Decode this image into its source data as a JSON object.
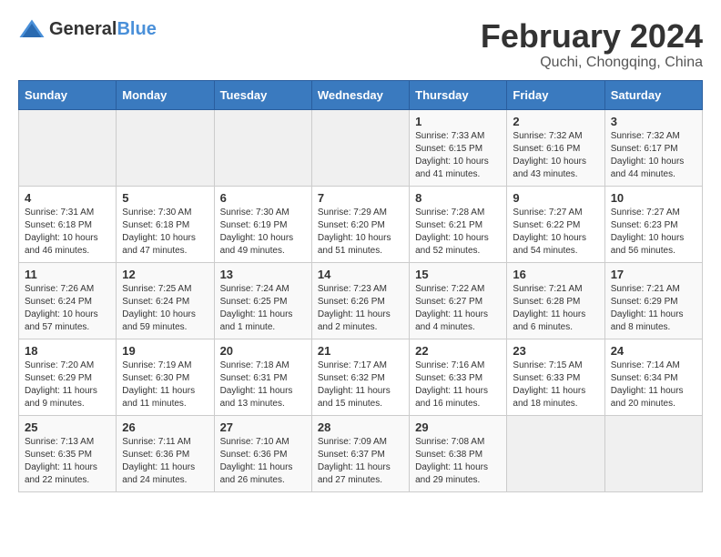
{
  "header": {
    "logo_general": "General",
    "logo_blue": "Blue",
    "month_year": "February 2024",
    "location": "Quchi, Chongqing, China"
  },
  "weekdays": [
    "Sunday",
    "Monday",
    "Tuesday",
    "Wednesday",
    "Thursday",
    "Friday",
    "Saturday"
  ],
  "weeks": [
    [
      {
        "day": "",
        "info": ""
      },
      {
        "day": "",
        "info": ""
      },
      {
        "day": "",
        "info": ""
      },
      {
        "day": "",
        "info": ""
      },
      {
        "day": "1",
        "info": "Sunrise: 7:33 AM\nSunset: 6:15 PM\nDaylight: 10 hours\nand 41 minutes."
      },
      {
        "day": "2",
        "info": "Sunrise: 7:32 AM\nSunset: 6:16 PM\nDaylight: 10 hours\nand 43 minutes."
      },
      {
        "day": "3",
        "info": "Sunrise: 7:32 AM\nSunset: 6:17 PM\nDaylight: 10 hours\nand 44 minutes."
      }
    ],
    [
      {
        "day": "4",
        "info": "Sunrise: 7:31 AM\nSunset: 6:18 PM\nDaylight: 10 hours\nand 46 minutes."
      },
      {
        "day": "5",
        "info": "Sunrise: 7:30 AM\nSunset: 6:18 PM\nDaylight: 10 hours\nand 47 minutes."
      },
      {
        "day": "6",
        "info": "Sunrise: 7:30 AM\nSunset: 6:19 PM\nDaylight: 10 hours\nand 49 minutes."
      },
      {
        "day": "7",
        "info": "Sunrise: 7:29 AM\nSunset: 6:20 PM\nDaylight: 10 hours\nand 51 minutes."
      },
      {
        "day": "8",
        "info": "Sunrise: 7:28 AM\nSunset: 6:21 PM\nDaylight: 10 hours\nand 52 minutes."
      },
      {
        "day": "9",
        "info": "Sunrise: 7:27 AM\nSunset: 6:22 PM\nDaylight: 10 hours\nand 54 minutes."
      },
      {
        "day": "10",
        "info": "Sunrise: 7:27 AM\nSunset: 6:23 PM\nDaylight: 10 hours\nand 56 minutes."
      }
    ],
    [
      {
        "day": "11",
        "info": "Sunrise: 7:26 AM\nSunset: 6:24 PM\nDaylight: 10 hours\nand 57 minutes."
      },
      {
        "day": "12",
        "info": "Sunrise: 7:25 AM\nSunset: 6:24 PM\nDaylight: 10 hours\nand 59 minutes."
      },
      {
        "day": "13",
        "info": "Sunrise: 7:24 AM\nSunset: 6:25 PM\nDaylight: 11 hours\nand 1 minute."
      },
      {
        "day": "14",
        "info": "Sunrise: 7:23 AM\nSunset: 6:26 PM\nDaylight: 11 hours\nand 2 minutes."
      },
      {
        "day": "15",
        "info": "Sunrise: 7:22 AM\nSunset: 6:27 PM\nDaylight: 11 hours\nand 4 minutes."
      },
      {
        "day": "16",
        "info": "Sunrise: 7:21 AM\nSunset: 6:28 PM\nDaylight: 11 hours\nand 6 minutes."
      },
      {
        "day": "17",
        "info": "Sunrise: 7:21 AM\nSunset: 6:29 PM\nDaylight: 11 hours\nand 8 minutes."
      }
    ],
    [
      {
        "day": "18",
        "info": "Sunrise: 7:20 AM\nSunset: 6:29 PM\nDaylight: 11 hours\nand 9 minutes."
      },
      {
        "day": "19",
        "info": "Sunrise: 7:19 AM\nSunset: 6:30 PM\nDaylight: 11 hours\nand 11 minutes."
      },
      {
        "day": "20",
        "info": "Sunrise: 7:18 AM\nSunset: 6:31 PM\nDaylight: 11 hours\nand 13 minutes."
      },
      {
        "day": "21",
        "info": "Sunrise: 7:17 AM\nSunset: 6:32 PM\nDaylight: 11 hours\nand 15 minutes."
      },
      {
        "day": "22",
        "info": "Sunrise: 7:16 AM\nSunset: 6:33 PM\nDaylight: 11 hours\nand 16 minutes."
      },
      {
        "day": "23",
        "info": "Sunrise: 7:15 AM\nSunset: 6:33 PM\nDaylight: 11 hours\nand 18 minutes."
      },
      {
        "day": "24",
        "info": "Sunrise: 7:14 AM\nSunset: 6:34 PM\nDaylight: 11 hours\nand 20 minutes."
      }
    ],
    [
      {
        "day": "25",
        "info": "Sunrise: 7:13 AM\nSunset: 6:35 PM\nDaylight: 11 hours\nand 22 minutes."
      },
      {
        "day": "26",
        "info": "Sunrise: 7:11 AM\nSunset: 6:36 PM\nDaylight: 11 hours\nand 24 minutes."
      },
      {
        "day": "27",
        "info": "Sunrise: 7:10 AM\nSunset: 6:36 PM\nDaylight: 11 hours\nand 26 minutes."
      },
      {
        "day": "28",
        "info": "Sunrise: 7:09 AM\nSunset: 6:37 PM\nDaylight: 11 hours\nand 27 minutes."
      },
      {
        "day": "29",
        "info": "Sunrise: 7:08 AM\nSunset: 6:38 PM\nDaylight: 11 hours\nand 29 minutes."
      },
      {
        "day": "",
        "info": ""
      },
      {
        "day": "",
        "info": ""
      }
    ]
  ]
}
